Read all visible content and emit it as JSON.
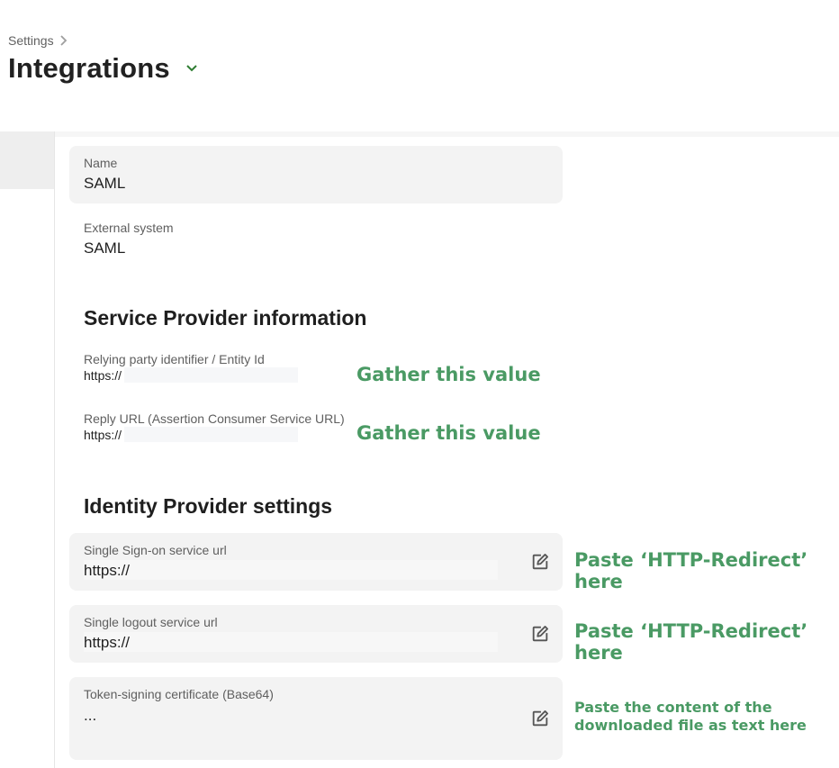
{
  "breadcrumb": {
    "parent": "Settings"
  },
  "page": {
    "title": "Integrations"
  },
  "fields": {
    "name": {
      "label": "Name",
      "value": "SAML"
    },
    "external_system": {
      "label": "External system",
      "value": "SAML"
    }
  },
  "sp_section": {
    "title": "Service Provider information",
    "entity_id": {
      "label": "Relying party identifier / Entity Id",
      "value": "https://"
    },
    "reply_url": {
      "label": "Reply URL (Assertion Consumer Service URL)",
      "value": "https://"
    }
  },
  "idp_section": {
    "title": "Identity Provider settings",
    "sso_url": {
      "label": "Single Sign-on service url",
      "value": "https://"
    },
    "logout_url": {
      "label": "Single logout service url",
      "value": "https://"
    },
    "certificate": {
      "label": "Token-signing certificate (Base64)",
      "value": "..."
    }
  },
  "annotations": {
    "gather_1": "Gather this value",
    "gather_2": "Gather this value",
    "paste_sso": "Paste ‘HTTP-Redirect’ here",
    "paste_logout": "Paste ‘HTTP-Redirect’ here",
    "paste_cert": "Paste the content of the downloaded file as text here"
  },
  "icons": {
    "breadcrumb_separator": "chevron-right-icon",
    "title_dropdown": "chevron-down-icon",
    "edit": "edit-icon"
  },
  "colors": {
    "annotation": "#4a9a64",
    "field_bg": "#f3f3f3",
    "accent": "#2e7d32"
  }
}
